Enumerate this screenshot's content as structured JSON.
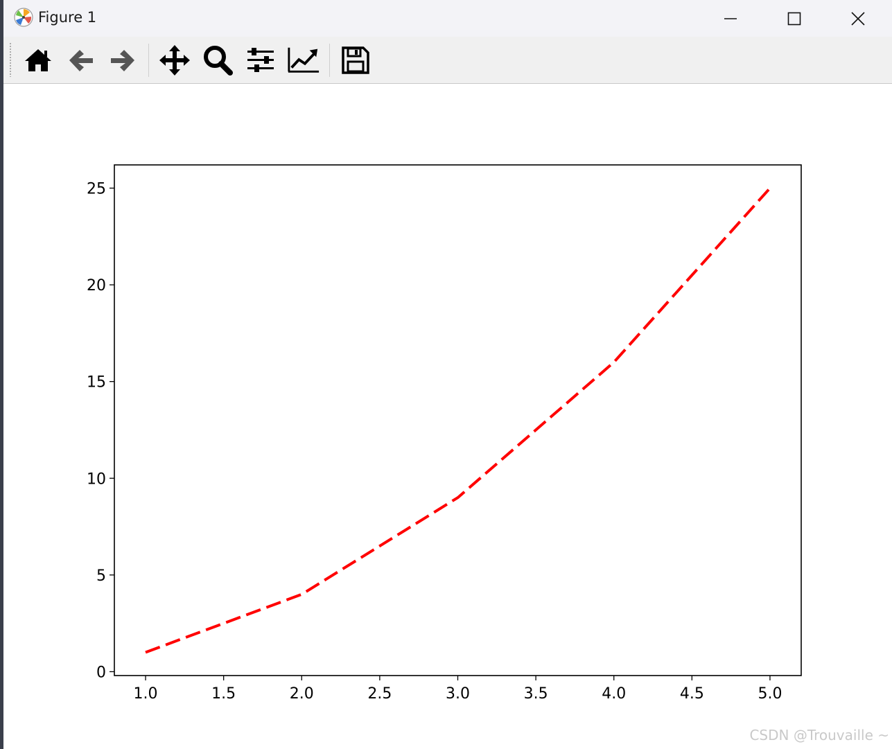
{
  "window": {
    "title": "Figure 1",
    "controls": [
      "minimize",
      "maximize",
      "close"
    ]
  },
  "toolbar": {
    "tools": [
      {
        "name": "home",
        "icon": "home-icon"
      },
      {
        "name": "back",
        "icon": "arrow-left-icon"
      },
      {
        "name": "forward",
        "icon": "arrow-right-icon"
      },
      {
        "name": "pan",
        "icon": "move-icon"
      },
      {
        "name": "zoom",
        "icon": "magnifier-icon"
      },
      {
        "name": "configure-subplots",
        "icon": "sliders-icon"
      },
      {
        "name": "edit-axis",
        "icon": "line-chart-icon"
      },
      {
        "name": "save",
        "icon": "floppy-disk-icon"
      }
    ]
  },
  "chart_data": {
    "type": "line",
    "x": [
      1,
      2,
      3,
      4,
      5
    ],
    "series": [
      {
        "values": [
          1,
          4,
          9,
          16,
          25
        ],
        "color": "#ff0000",
        "linestyle": "dashed"
      }
    ],
    "xlim": [
      0.8,
      5.2
    ],
    "ylim": [
      -0.2,
      26.2
    ],
    "xticks": [
      "1.0",
      "1.5",
      "2.0",
      "2.5",
      "3.0",
      "3.5",
      "4.0",
      "4.5",
      "5.0"
    ],
    "yticks": [
      "0",
      "5",
      "10",
      "15",
      "20",
      "25"
    ],
    "title": "",
    "xlabel": "",
    "ylabel": "",
    "grid": false
  },
  "watermark": "CSDN @Trouvaille ~"
}
